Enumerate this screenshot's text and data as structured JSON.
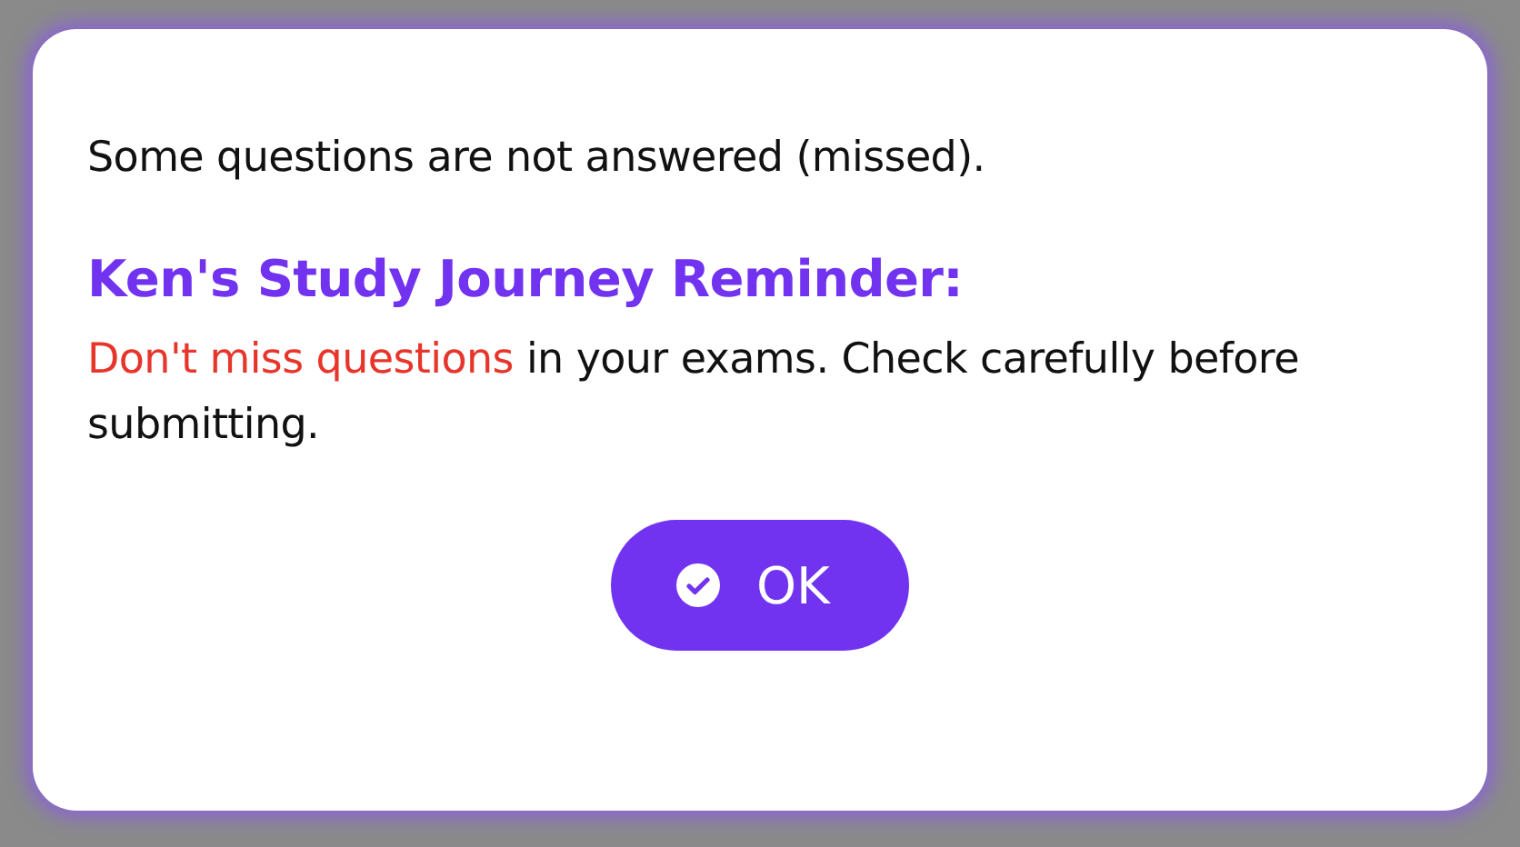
{
  "dialog": {
    "message": "Some questions are not answered (missed).",
    "reminder_title": "Ken's Study Journey Reminder:",
    "reminder_highlight": "Don't miss questions",
    "reminder_text": " in your exams. Check carefully before submitting.",
    "buttons": [
      {
        "kind": "confirm",
        "label": "OK"
      }
    ]
  }
}
